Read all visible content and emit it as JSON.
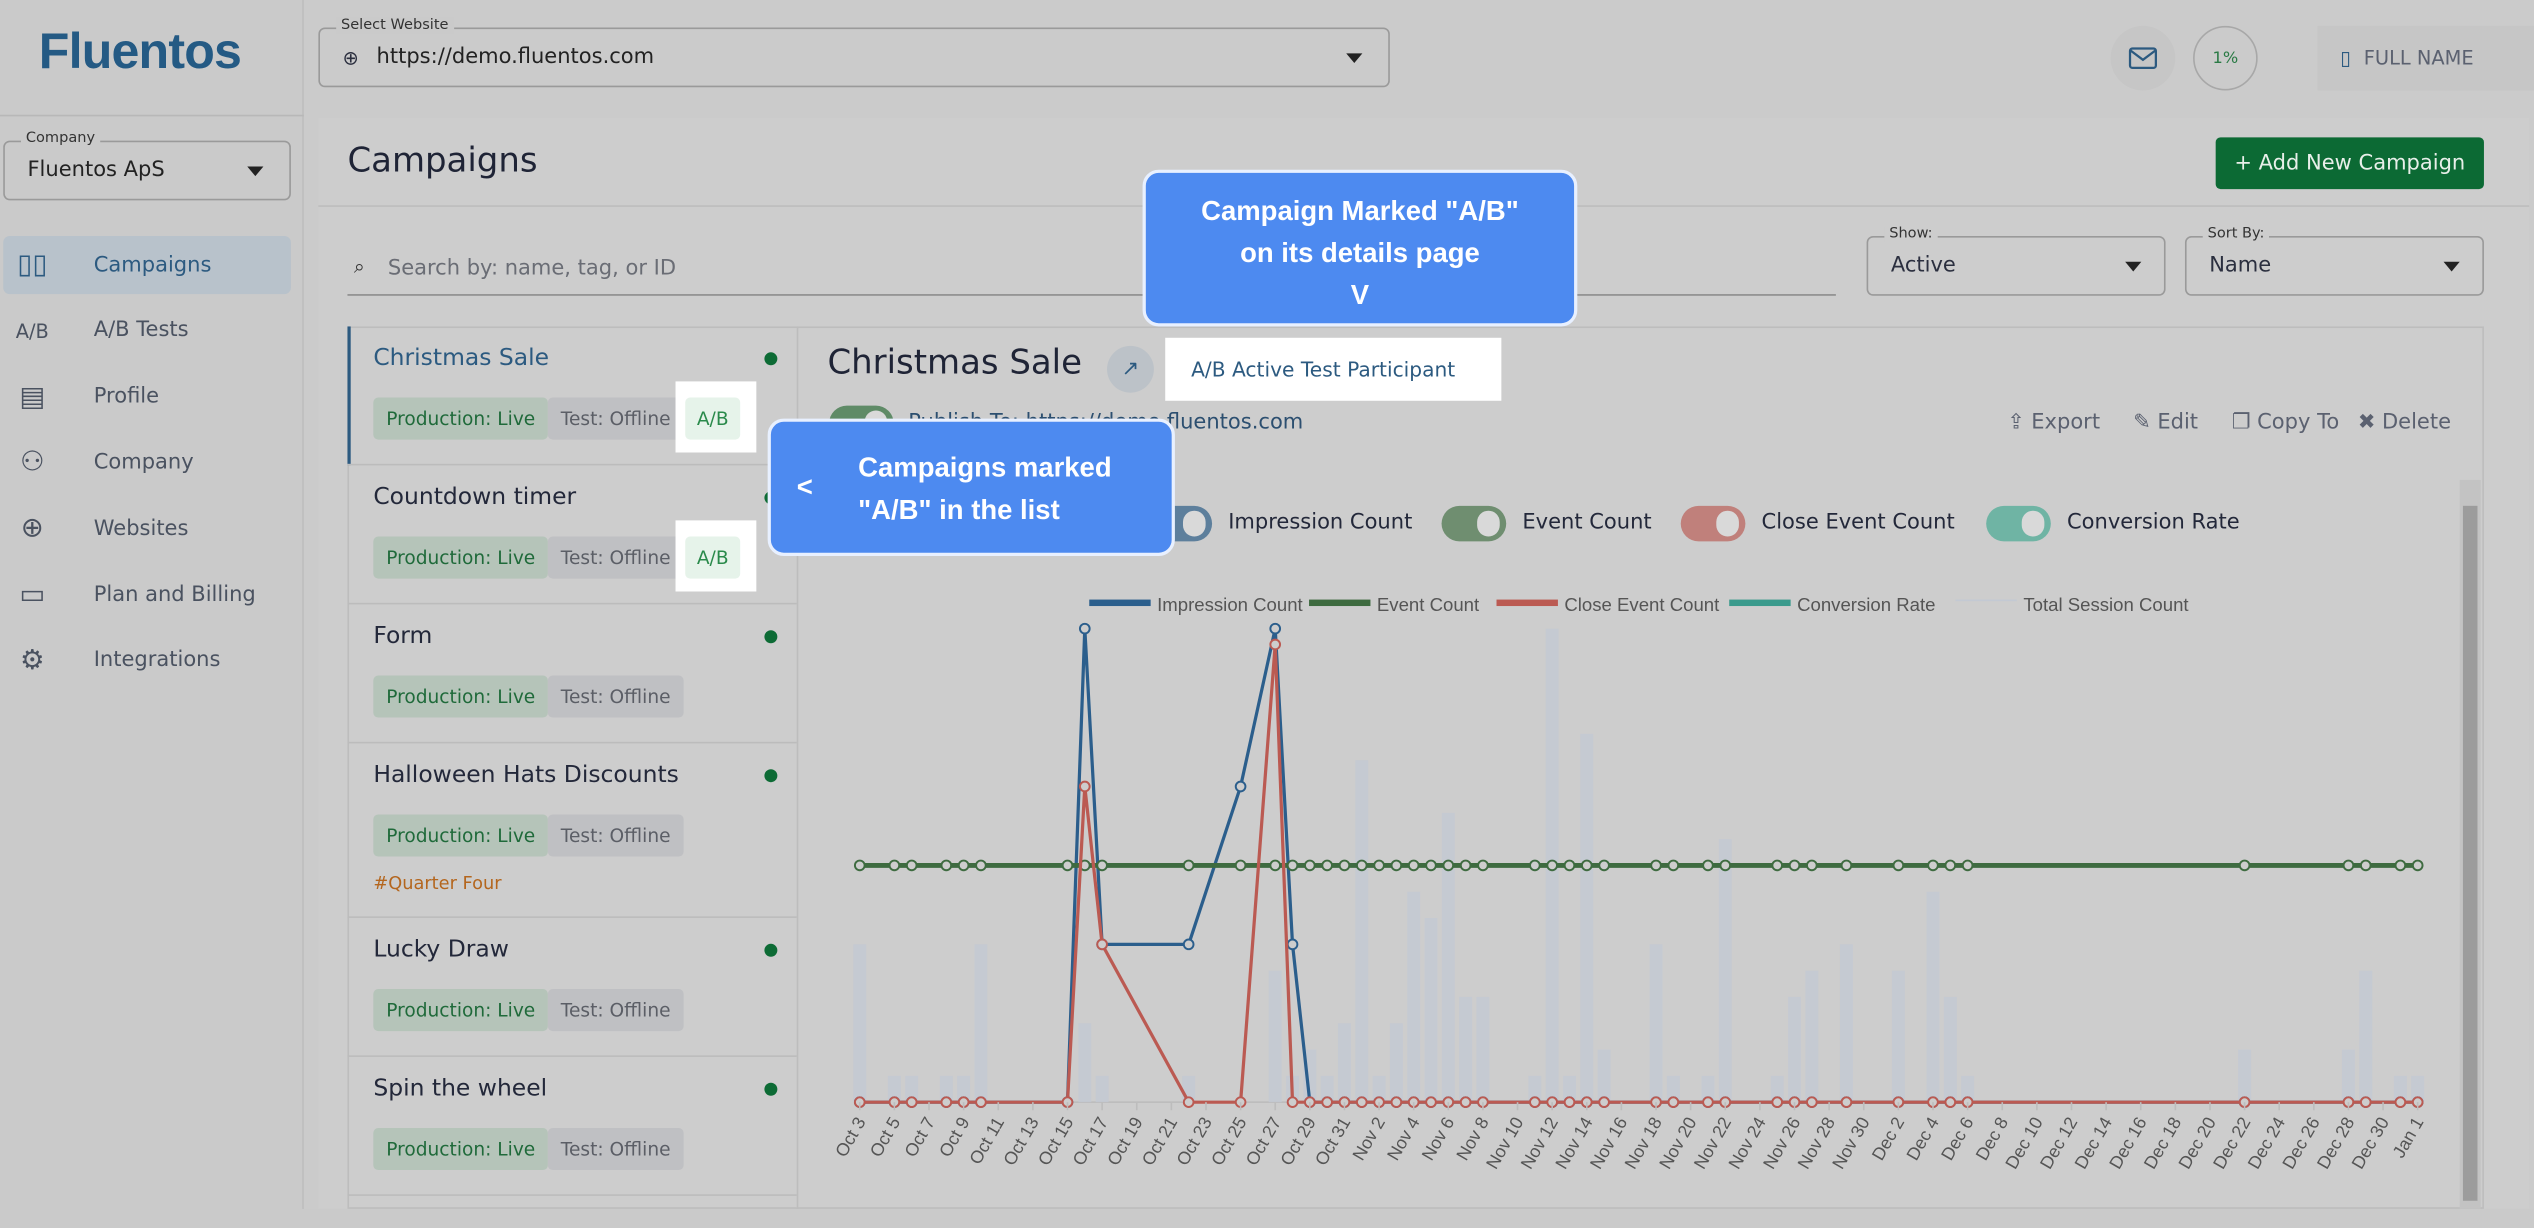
{
  "app": {
    "logo": "Fluentos"
  },
  "header": {
    "website_label": "Select Website",
    "website_value": "https://demo.fluentos.com",
    "progress": "1%",
    "progress_percent": 1,
    "user": "FULL NAME"
  },
  "sidebar": {
    "company_label": "Company",
    "company_value": "Fluentos ApS",
    "items": [
      {
        "label": "Campaigns",
        "icon": "campaigns-icon",
        "active": true
      },
      {
        "label": "A/B Tests",
        "icon": "ab-icon"
      },
      {
        "label": "Profile",
        "icon": "profile-icon"
      },
      {
        "label": "Company",
        "icon": "company-icon"
      },
      {
        "label": "Websites",
        "icon": "globe-icon"
      },
      {
        "label": "Plan and Billing",
        "icon": "credit-card-icon"
      },
      {
        "label": "Integrations",
        "icon": "gear-icon"
      }
    ]
  },
  "page": {
    "title": "Campaigns",
    "add_button": "+ Add New Campaign",
    "search_placeholder": "Search by: name, tag, or ID",
    "show_label": "Show:",
    "show_value": "Active",
    "sort_label": "Sort By:",
    "sort_value": "Name"
  },
  "campaigns": [
    {
      "name": "Christmas Sale",
      "production": "Production: Live",
      "test": "Test: Offline",
      "ab": "A/B",
      "status_color": "#0d6b35"
    },
    {
      "name": "Countdown timer",
      "production": "Production: Live",
      "test": "Test: Offline",
      "ab": "A/B"
    },
    {
      "name": "Form",
      "production": "Production: Live",
      "test": "Test: Offline"
    },
    {
      "name": "Halloween Hats Discounts",
      "production": "Production: Live",
      "test": "Test: Offline",
      "tag": "#Quarter Four"
    },
    {
      "name": "Lucky Draw",
      "production": "Production: Live",
      "test": "Test: Offline"
    },
    {
      "name": "Spin the wheel",
      "production": "Production: Live",
      "test": "Test: Offline"
    }
  ],
  "detail": {
    "title": "Christmas Sale",
    "ab_label": "A/B Active Test Participant",
    "publish": "Publish To: https://demo.fluentos.com",
    "actions": [
      "Export",
      "Edit",
      "Copy To",
      "Delete"
    ],
    "toggles": [
      {
        "label": "Impression Count",
        "color": "#5d7f9c",
        "on": false
      },
      {
        "label": "Event Count",
        "color": "#6f8e70",
        "on": true
      },
      {
        "label": "Close Event Count",
        "color": "#c0807b",
        "on": true
      },
      {
        "label": "Conversion Rate",
        "color": "#6fb4a4",
        "on": true
      }
    ]
  },
  "callouts": {
    "details": [
      "Campaign Marked \"A/B\"",
      "on its details page",
      "V"
    ],
    "list_arrow": "<",
    "list": [
      "Campaigns marked",
      "\"A/B\" in the list"
    ]
  },
  "chart_data": {
    "type": "line",
    "x_range": [
      "Oct 3",
      "Jan 1"
    ],
    "x_ticks": [
      "Oct 3",
      "Oct 5",
      "Oct 7",
      "Oct 9",
      "Oct 11",
      "Oct 13",
      "Oct 15",
      "Oct 17",
      "Oct 19",
      "Oct 21",
      "Oct 23",
      "Oct 25",
      "Oct 27",
      "Oct 29",
      "Oct 31",
      "Nov 2",
      "Nov 4",
      "Nov 6",
      "Nov 8",
      "Nov 10",
      "Nov 12",
      "Nov 14",
      "Nov 16",
      "Nov 18",
      "Nov 20",
      "Nov 22",
      "Nov 24",
      "Nov 26",
      "Nov 28",
      "Nov 30",
      "Dec 2",
      "Dec 4",
      "Dec 6",
      "Dec 8",
      "Dec 10",
      "Dec 12",
      "Dec 14",
      "Dec 16",
      "Dec 18",
      "Dec 20",
      "Dec 22",
      "Dec 24",
      "Dec 26",
      "Dec 28",
      "Dec 30",
      "Jan 1"
    ],
    "legend": [
      "Impression Count",
      "Event Count",
      "Close Event Count",
      "Conversion Rate",
      "Total Session Count"
    ],
    "legend_position": "top",
    "ylim": [
      0,
      3
    ],
    "bar_ylim": [
      0,
      18
    ],
    "dates": [
      "Oct 3",
      "Oct 5",
      "Oct 6",
      "Oct 8",
      "Oct 9",
      "Oct 10",
      "Oct 15",
      "Oct 16",
      "Oct 17",
      "Oct 22",
      "Oct 25",
      "Oct 27",
      "Oct 28",
      "Oct 29",
      "Oct 30",
      "Oct 31",
      "Nov 1",
      "Nov 2",
      "Nov 3",
      "Nov 4",
      "Nov 5",
      "Nov 6",
      "Nov 7",
      "Nov 8",
      "Nov 11",
      "Nov 12",
      "Nov 13",
      "Nov 14",
      "Nov 15",
      "Nov 18",
      "Nov 19",
      "Nov 21",
      "Nov 22",
      "Nov 25",
      "Nov 26",
      "Nov 27",
      "Nov 29",
      "Dec 2",
      "Dec 4",
      "Dec 5",
      "Dec 6",
      "Dec 22",
      "Dec 28",
      "Dec 29",
      "Dec 31",
      "Jan 1"
    ],
    "series": [
      {
        "name": "Impression Count",
        "color": "#2b5e8c",
        "values": [
          0,
          0,
          0,
          0,
          0,
          0,
          0,
          3,
          1,
          1,
          2,
          3,
          1,
          0,
          0,
          0,
          0,
          0,
          0,
          0,
          0,
          0,
          0,
          0,
          0,
          0,
          0,
          0,
          0,
          0,
          0,
          0,
          0,
          0,
          0,
          0,
          0,
          0,
          0,
          0,
          0,
          0,
          0,
          0,
          0,
          0
        ]
      },
      {
        "name": "Event Count",
        "color": "#3e6b40",
        "values": [
          1.5,
          1.5,
          1.5,
          1.5,
          1.5,
          1.5,
          1.5,
          1.5,
          1.5,
          1.5,
          1.5,
          1.5,
          1.5,
          1.5,
          1.5,
          1.5,
          1.5,
          1.5,
          1.5,
          1.5,
          1.5,
          1.5,
          1.5,
          1.5,
          1.5,
          1.5,
          1.5,
          1.5,
          1.5,
          1.5,
          1.5,
          1.5,
          1.5,
          1.5,
          1.5,
          1.5,
          1.5,
          1.5,
          1.5,
          1.5,
          1.5,
          1.5,
          1.5,
          1.5,
          1.5,
          1.5
        ]
      },
      {
        "name": "Close Event Count",
        "color": "#bb5a52",
        "values": [
          0,
          0,
          0,
          0,
          0,
          0,
          0,
          2,
          1,
          0,
          0,
          2.9,
          0,
          0,
          0,
          0,
          0,
          0,
          0,
          0,
          0,
          0,
          0,
          0,
          0,
          0,
          0,
          0,
          0,
          0,
          0,
          0,
          0,
          0,
          0,
          0,
          0,
          0,
          0,
          0,
          0,
          0,
          0,
          0,
          0,
          0
        ]
      },
      {
        "name": "Conversion Rate",
        "color": "#3a9a8c",
        "values": []
      },
      {
        "name": "Total Session Count",
        "type": "bar",
        "color": "#c3c9d3",
        "values": [
          6,
          1,
          1,
          1,
          1,
          6,
          0,
          3,
          1,
          1,
          0,
          5,
          1,
          2,
          1,
          3,
          13,
          1,
          3,
          8,
          7,
          11,
          4,
          4,
          1,
          18,
          1,
          14,
          2,
          6,
          1,
          1,
          10,
          1,
          4,
          5,
          6,
          5,
          8,
          4,
          1,
          2,
          2,
          5,
          1,
          1
        ]
      }
    ]
  }
}
